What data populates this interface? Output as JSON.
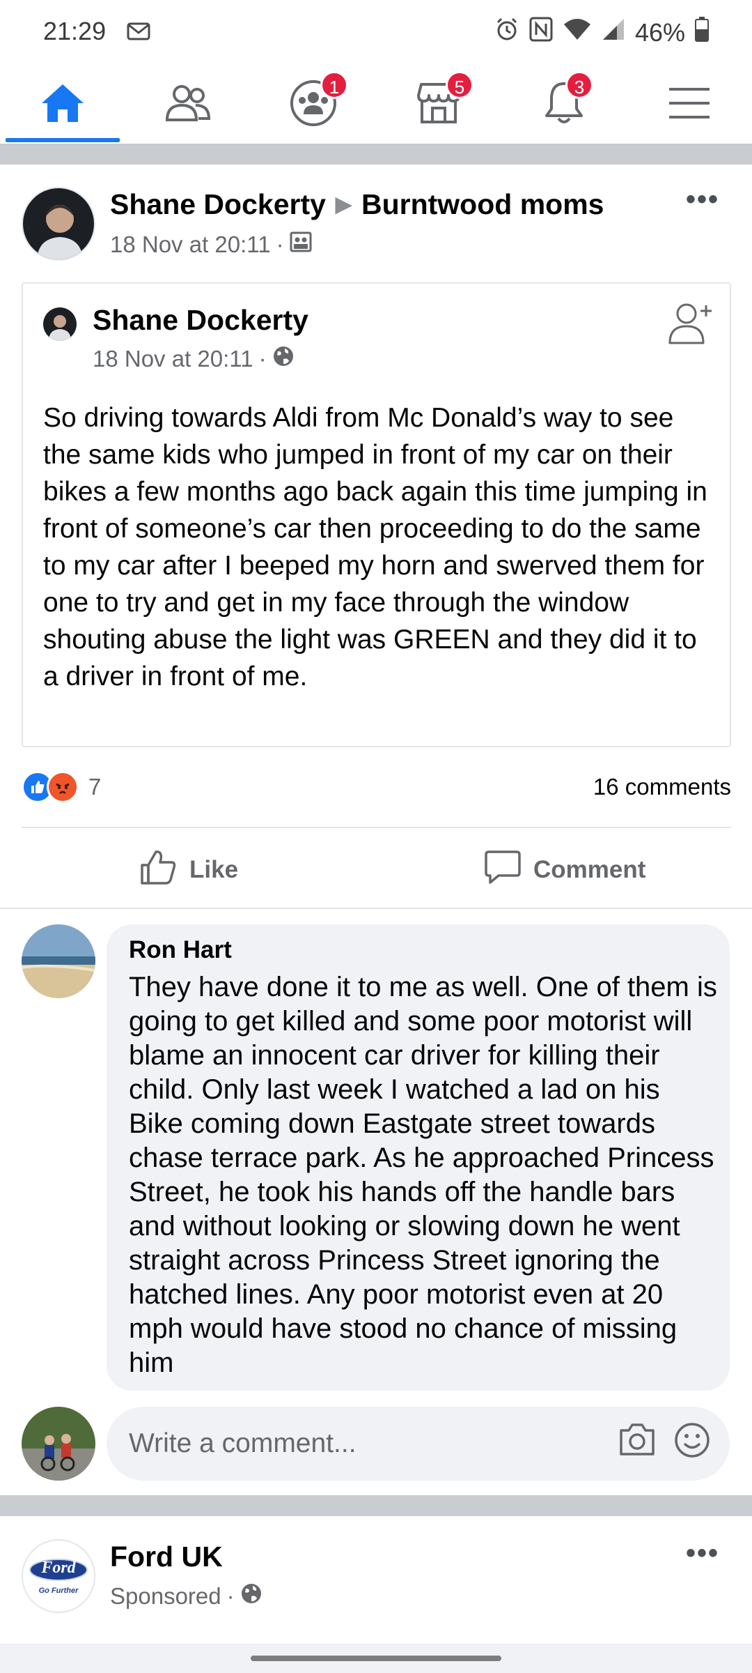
{
  "status_bar": {
    "time": "21:29",
    "battery": "46%",
    "icons": [
      "gmail-icon",
      "alarm-icon",
      "nfc-icon",
      "wifi-icon",
      "signal-icon",
      "battery-icon"
    ]
  },
  "nav": {
    "items": [
      {
        "name": "home",
        "icon": "home-icon",
        "active": true
      },
      {
        "name": "friends",
        "icon": "friends-icon"
      },
      {
        "name": "groups",
        "icon": "groups-icon",
        "badge": "1"
      },
      {
        "name": "marketplace",
        "icon": "marketplace-icon",
        "badge": "5"
      },
      {
        "name": "notifications",
        "icon": "bell-icon",
        "badge": "3"
      },
      {
        "name": "menu",
        "icon": "hamburger-menu-icon"
      }
    ],
    "accent_color": "#1877f2"
  },
  "post": {
    "author": "Shane Dockerty",
    "group": "Burntwood moms",
    "time": "18 Nov at 20:11",
    "separator": "·",
    "shared": {
      "author": "Shane Dockerty",
      "time": "18 Nov at 20:11",
      "separator": "·",
      "text": "So driving towards Aldi from Mc Donald’s way to see the same kids who jumped in front of my car on their bikes a few months ago back again this time jumping in front of someone’s car then proceeding to do the same to my car after I beeped my horn and swerved them for one to try and get in my face through the window shouting abuse the light was GREEN and they did it to a driver in front of me."
    },
    "reaction_count": "7",
    "comments_count": "16 comments",
    "actions": {
      "like": "Like",
      "comment": "Comment"
    }
  },
  "comment": {
    "author": "Ron Hart",
    "text": "They have done it to me as well. One of them is going to get killed and some poor motorist will blame an innocent car driver for killing their child. Only last week I watched a lad on his Bike coming down Eastgate  street towards chase terrace park. As he approached Princess Street, he took his hands off the handle bars and without looking or slowing down he went straight across Princess Street ignoring the hatched lines. Any poor motorist even at 20 mph would have stood no chance of missing him"
  },
  "write_comment": {
    "placeholder": "Write a comment..."
  },
  "sponsored": {
    "author": "Ford UK",
    "label": "Sponsored",
    "separator": "·",
    "logo_text": "Ford",
    "logo_tagline": "Go Further"
  }
}
